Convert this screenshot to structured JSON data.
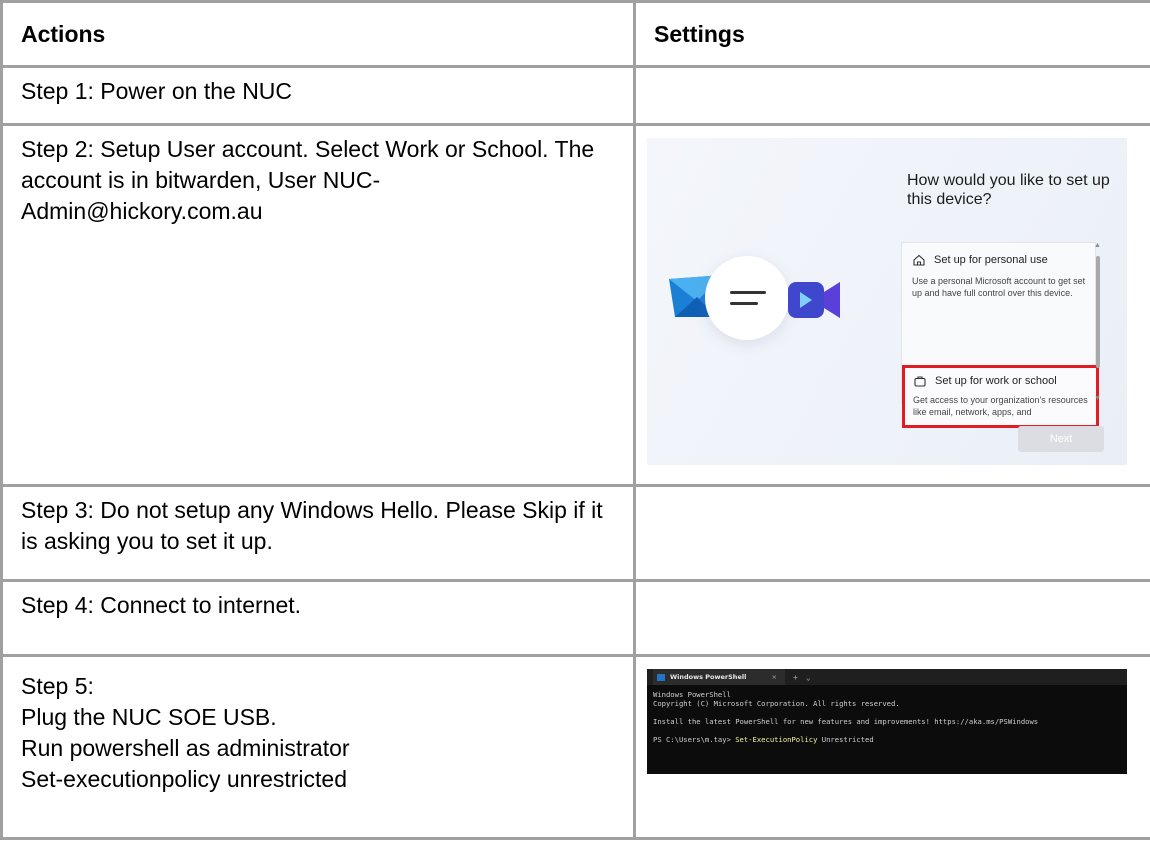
{
  "headers": {
    "actions": "Actions",
    "settings": "Settings"
  },
  "rows": [
    {
      "action": "Step 1:  Power on the NUC"
    },
    {
      "action": "Step 2:  Setup User account. Select Work or School. The account is in bitwarden, User NUC-Admin@hickory.com.au"
    },
    {
      "action": "Step 3: Do not setup any Windows Hello.  Please Skip if it is asking you to set it up."
    },
    {
      "action": "Step 4: Connect to internet."
    },
    {
      "action_lines": [
        "Step 5:",
        "Plug the NUC SOE USB.",
        "Run powershell as administrator",
        "Set-executionpolicy unrestricted"
      ]
    }
  ],
  "oobe": {
    "question": "How would you like to set up this device?",
    "option_personal_title": "Set up for personal use",
    "option_personal_desc": "Use a personal Microsoft account to get set up and have full control over this device.",
    "option_work_title": "Set up for work or school",
    "option_work_desc": "Get access to your organization's resources like email, network, apps, and",
    "next_label": "Next",
    "highlight_color": "#e01d24"
  },
  "powershell": {
    "tab_title": "Windows PowerShell",
    "tab_close": "×",
    "tab_plus": "+",
    "tab_chevron": "⌄",
    "line1": "Windows PowerShell",
    "line2": "Copyright (C) Microsoft Corporation. All rights reserved.",
    "line3": "Install the latest PowerShell for new features and improvements! https://aka.ms/PSWindows",
    "prompt": "PS C:\\Users\\m.tay> ",
    "command": "Set-ExecutionPolicy",
    "argument": " Unrestricted"
  }
}
